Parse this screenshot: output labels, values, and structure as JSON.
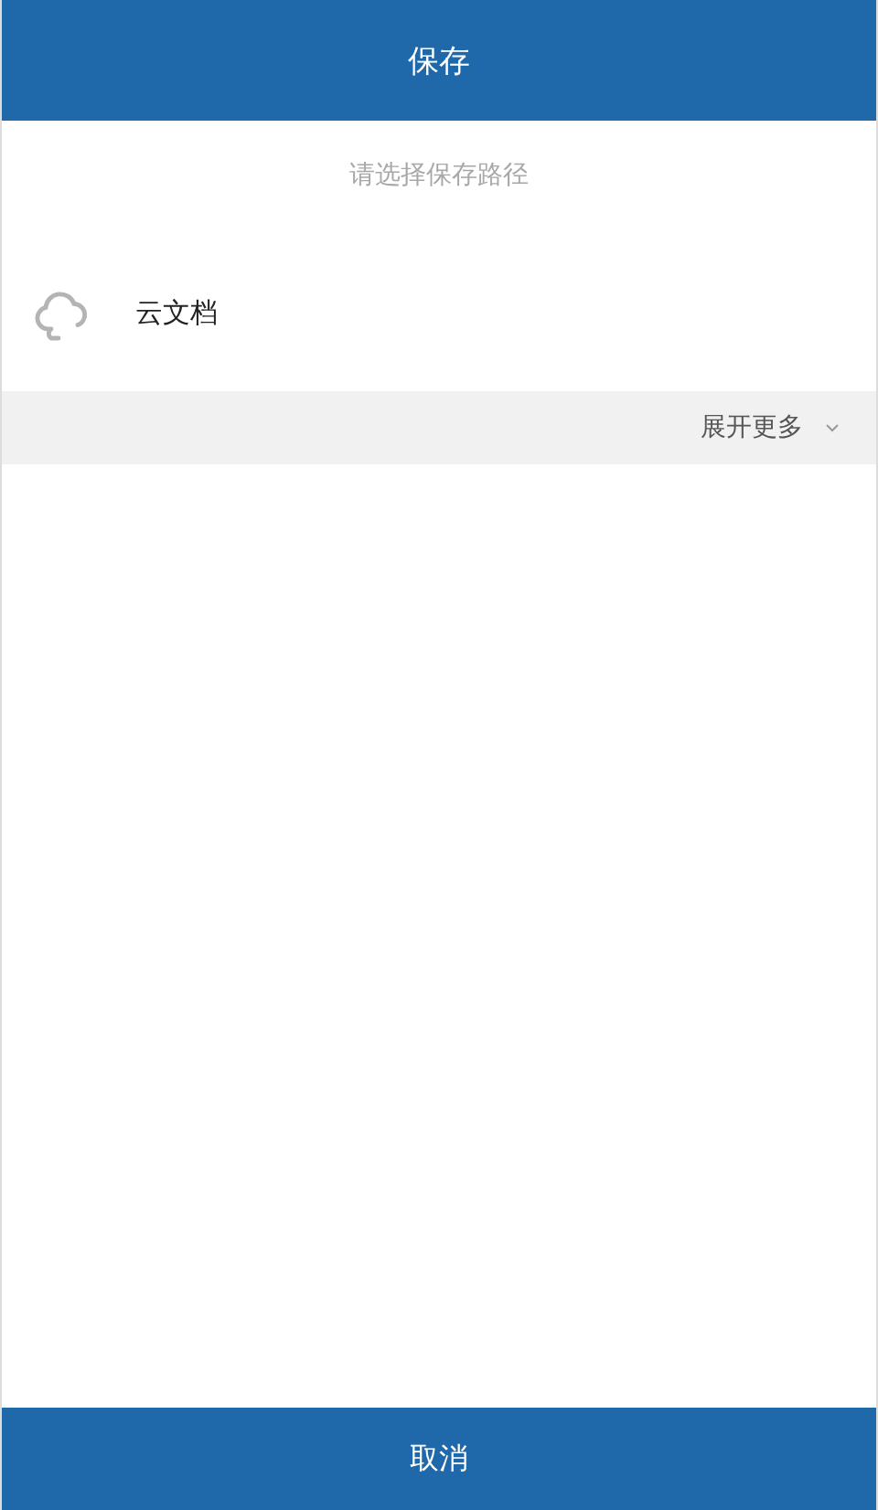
{
  "header": {
    "title": "保存"
  },
  "hint": "请选择保存路径",
  "locations": [
    {
      "label": "云文档"
    }
  ],
  "expand": {
    "label": "展开更多"
  },
  "footer": {
    "button": "取消"
  }
}
